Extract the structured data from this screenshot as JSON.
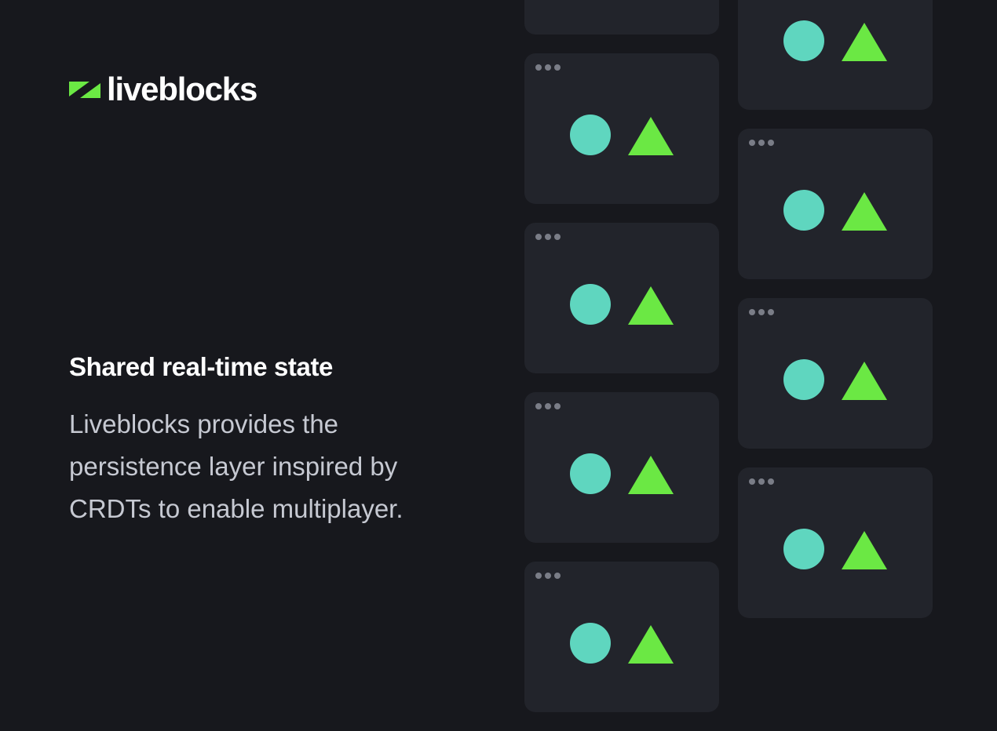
{
  "brand": {
    "name": "liveblocks",
    "colors": {
      "background": "#17181d",
      "card": "#22242b",
      "accent_green": "#6be844",
      "shape_teal": "#5fd6bf",
      "shape_green": "#6be844",
      "window_dot": "#7a7d87",
      "body_text": "#c6c9d2"
    }
  },
  "hero": {
    "headline": "Shared real-time state",
    "description_lines": [
      "Liveblocks provides the",
      "persistence layer inspired by",
      "CRDTs to enable multiplayer."
    ]
  },
  "illustration": {
    "window_icon": "window-dots-icon",
    "shapes": [
      "circle-icon",
      "triangle-icon"
    ],
    "columns": [
      {
        "windows": 5
      },
      {
        "windows": 4
      }
    ]
  }
}
